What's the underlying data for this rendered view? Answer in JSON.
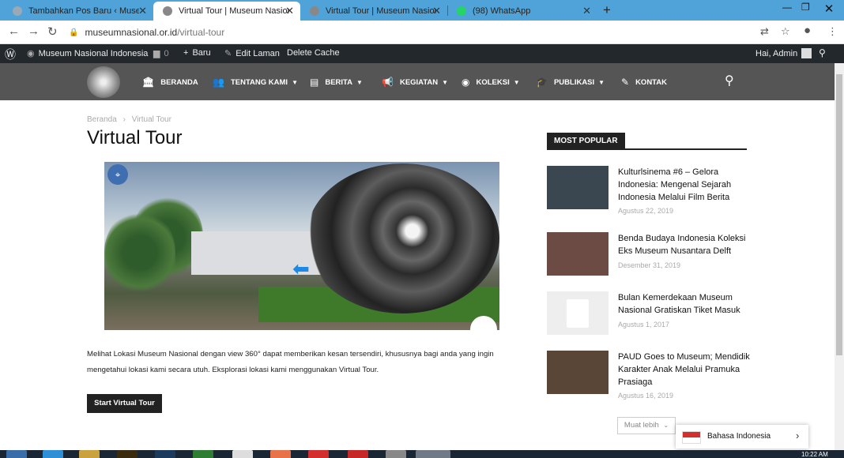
{
  "browser": {
    "tabs": [
      {
        "title": "Tambahkan Pos Baru ‹ Museum N",
        "active": false,
        "favicon_color": "#9aa9b6"
      },
      {
        "title": "Virtual Tour | Museum Nasional Indo",
        "active": true,
        "favicon_color": "#888888"
      },
      {
        "title": "Virtual Tour | Museum Nasional Indo",
        "active": false,
        "favicon_color": "#888888"
      },
      {
        "title": "(98) WhatsApp",
        "active": false,
        "favicon_color": "#25d366"
      }
    ],
    "url_host": "museumnasional.or.id",
    "url_path": "/virtual-tour"
  },
  "wpadmin": {
    "site_name": "Museum Nasional Indonesia",
    "comments": "0",
    "new_label": "Baru",
    "edit_label": "Edit Laman",
    "cache_label": "Delete Cache",
    "greeting": "Hai, Admin"
  },
  "nav": {
    "items": [
      {
        "label": "BERANDA",
        "icon": "bank-icon",
        "dropdown": false
      },
      {
        "label": "TENTANG KAMI",
        "icon": "users-icon",
        "dropdown": true
      },
      {
        "label": "BERITA",
        "icon": "newspaper-icon",
        "dropdown": true
      },
      {
        "label": "KEGIATAN",
        "icon": "megaphone-icon",
        "dropdown": true
      },
      {
        "label": "KOLEKSI",
        "icon": "target-icon",
        "dropdown": true
      },
      {
        "label": "PUBLIKASI",
        "icon": "graduation-cap-icon",
        "dropdown": true
      },
      {
        "label": "KONTAK",
        "icon": "edit-icon",
        "dropdown": false
      }
    ]
  },
  "page": {
    "breadcrumb_home": "Beranda",
    "breadcrumb_sep": "›",
    "breadcrumb_current": "Virtual Tour",
    "title": "Virtual Tour",
    "description": "Melihat Lokasi Museum Nasional dengan view 360° dapat memberikan kesan tersendiri, khususnya bagi anda yang ingin mengetahui lokasi kami secara utuh. Eksplorasi lokasi kami menggunakan Virtual Tour.",
    "cta": "Start Virtual Tour"
  },
  "sidebar": {
    "heading": "MOST POPULAR",
    "posts": [
      {
        "title": "Kulturlsinema #6 – Gelora Indonesia: Mengenal Sejarah Indonesia Melalui Film Berita",
        "date": "Agustus 22, 2019",
        "thumb": "#3a4650"
      },
      {
        "title": "Benda Budaya Indonesia Koleksi Eks Museum Nusantara Delft",
        "date": "Desember 31, 2019",
        "thumb": "#6b4b44"
      },
      {
        "title": "Bulan Kemerdekaan Museum Nasional Gratiskan Tiket Masuk",
        "date": "Agustus 1, 2017",
        "thumb": "#eeeeee"
      },
      {
        "title": "PAUD Goes to Museum; Mendidik Karakter Anak Melalui Pramuka Prasiaga",
        "date": "Agustus 16, 2019",
        "thumb": "#5a4636"
      }
    ],
    "more_label": "Muat lebih"
  },
  "language": {
    "label": "Bahasa Indonesia"
  },
  "clock": "10:22 AM"
}
